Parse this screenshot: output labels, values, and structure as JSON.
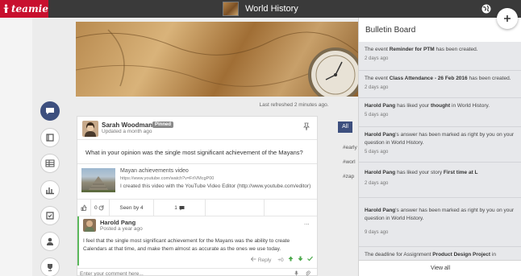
{
  "header": {
    "logo_text": "teamie",
    "course_title": "World History"
  },
  "feed": {
    "refresh_text": "Last refreshed 2 minutes ago.",
    "filter_all": "All",
    "hashtags": [
      "#early",
      "#worl",
      "#zap"
    ]
  },
  "post": {
    "author": "Sarah Woodman",
    "badge": "Pinned",
    "updated": "Updated a month ago",
    "question": "What in your opinion was the single most significant achievement of the Mayans?",
    "video": {
      "title": "Mayan achievements video",
      "url": "https://www.youtube.com/watch?v=FrlVMcgP00",
      "description": "I created this video with the YouTube Video Editor (http://www.youtube.com/editor)"
    },
    "actions": {
      "votes": "0",
      "seen": "Seen by 4",
      "comments": "1"
    },
    "reply": {
      "author": "Harold Pang",
      "time": "Posted a year ago",
      "more": "...",
      "text": "I feel that the single most significant achievement for the Mayans was the ability to create Calendars at that time, and make them almost as accurate as the ones we use today.",
      "reply_label": "Reply",
      "score": "+0"
    },
    "comment_placeholder": "Enter your comment here..."
  },
  "bulletin": {
    "title": "Bulletin Board",
    "entries": [
      {
        "pre": "The event ",
        "bold1": "Reminder for PTM",
        "mid": " has been created.",
        "bold2": "",
        "post": "",
        "time": "2 days ago"
      },
      {
        "pre": "The event ",
        "bold1": "Class Attendance - 26 Feb 2016",
        "mid": " has been created.",
        "bold2": "",
        "post": "",
        "time": "2 days ago"
      },
      {
        "pre": "",
        "bold1": "Harold Pang",
        "mid": " has liked your ",
        "bold2": "thought",
        "post": " in World History.",
        "time": "5 days ago"
      },
      {
        "pre": "",
        "bold1": "Harold Pang",
        "mid": "'s answer has been marked as right by you on your question in World History.",
        "bold2": "",
        "post": "",
        "time": "5 days ago"
      },
      {
        "pre": "",
        "bold1": "Harold Pang",
        "mid": " has liked your story ",
        "bold2": "First time at L",
        "post": "",
        "time": "2 days ago"
      },
      {
        "pre": "",
        "bold1": "Harold Pang",
        "mid": "'s answer has been marked as right by you on your question in World History.",
        "bold2": "",
        "post": "",
        "time": "9 days ago"
      },
      {
        "pre": "The deadline for Assignment ",
        "bold1": "Product Design Project",
        "mid": " in",
        "bold2": "",
        "post": "",
        "time": ""
      }
    ],
    "view_all": "View all"
  }
}
